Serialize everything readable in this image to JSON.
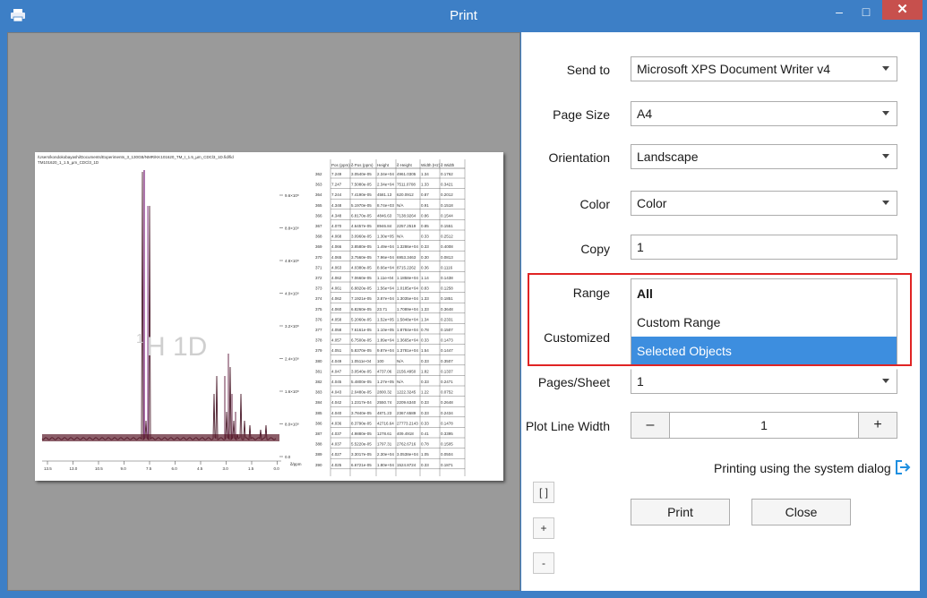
{
  "window": {
    "title": "Print",
    "minimize": "–",
    "maximize": "□",
    "close": "✕"
  },
  "preview": {
    "file_path": "/Users/kondokobayashi/Documents/Experiments_3_130GB/NMR/KK101620_TM_I_1.5_µm_CDCl3_1D.fid/fid",
    "file_name": "TM101620_1_1.5_µm_CDCl3_1D",
    "watermark_sup": "1",
    "watermark": "H 1D",
    "x_ticks": [
      "13.5",
      "13.0",
      "10.5",
      "9.0",
      "7.5",
      "6.0",
      "4.5",
      "3.0",
      "1.5",
      "0.0"
    ],
    "x_unit": "δ/ppm",
    "y_ticks": [
      "9.6×10⁸",
      "8.8×10⁸",
      "4.8×10⁸",
      "4.0×10⁸",
      "3.2×10⁸",
      "2.4×10⁸",
      "1.6×10⁸",
      "8.0×10⁸",
      "0.0"
    ],
    "table_headers": [
      "",
      "Pos (ppm)",
      "δ Pos (ppm)",
      "Height",
      "δ Height",
      "Width (Hz)",
      "δ Width"
    ],
    "table_rows": [
      [
        "362",
        "7.249",
        "3.0540e-05",
        "2.34e+04",
        "4961.0305",
        "1.34",
        "0.1762"
      ],
      [
        "363",
        "7.247",
        "7.5080e-05",
        "2.34e+04",
        "7511.0708",
        "1.33",
        "0.3421"
      ],
      [
        "364",
        "7.244",
        "7.4190e-05",
        "4581.13",
        "620.0912",
        "0.87",
        "0.2012"
      ],
      [
        "365",
        "4.348",
        "5.1970e-05",
        "8.74e+03",
        "N/A",
        "0.91",
        "0.1518"
      ],
      [
        "366",
        "4.348",
        "6.8170e-05",
        "4846.63",
        "7138.9264",
        "0.86",
        "0.1544"
      ],
      [
        "367",
        "4.070",
        "4.6457e-05",
        "8946.84",
        "2257.2519",
        "0.85",
        "0.1551"
      ],
      [
        "368",
        "4.068",
        "3.0960e-05",
        "1.30e+05",
        "N/A",
        "0.33",
        "0.2512"
      ],
      [
        "369",
        "4.066",
        "3.8580e-05",
        "1.49e+04",
        "1.3286e+04",
        "0.33",
        "0.4008"
      ],
      [
        "370",
        "4.065",
        "3.7560e-05",
        "7.96e+04",
        "6953.3463",
        "0.30",
        "0.0813"
      ],
      [
        "371",
        "4.063",
        "4.0380e-05",
        "8.66e+04",
        "8715.2262",
        "0.36",
        "0.1116"
      ],
      [
        "372",
        "4.062",
        "7.0660e-05",
        "1.11e+04",
        "1.1858e+04",
        "1.14",
        "0.1438"
      ],
      [
        "373",
        "4.061",
        "6.8820e-05",
        "1.56e+04",
        "1.0185e+04",
        "0.83",
        "0.1258"
      ],
      [
        "374",
        "4.062",
        "7.1921e-05",
        "3.87e+04",
        "1.3035e+04",
        "1.33",
        "0.1851"
      ],
      [
        "375",
        "4.060",
        "6.8260e-05",
        "23.71",
        "1.7089e+04",
        "1.33",
        "0.3648"
      ],
      [
        "376",
        "4.058",
        "5.2060e-05",
        "1.52e+05",
        "1.5848e+04",
        "1.34",
        "0.2331"
      ],
      [
        "377",
        "4.058",
        "7.6161e-05",
        "1.10e+05",
        "1.8784e+04",
        "0.78",
        "0.1507"
      ],
      [
        "378",
        "4.057",
        "6.7500e-05",
        "1.89e+04",
        "1.3665e+04",
        "0.33",
        "0.1473"
      ],
      [
        "379",
        "4.051",
        "5.8370e-05",
        "9.87e+04",
        "1.3781e+04",
        "1.54",
        "0.1447"
      ],
      [
        "380",
        "4.049",
        "1.0511e-04",
        "100",
        "N/A",
        "0.33",
        "0.3507"
      ],
      [
        "381",
        "4.047",
        "3.0540e-05",
        "4737.06",
        "2156.4950",
        "1.82",
        "0.1337"
      ],
      [
        "382",
        "4.045",
        "5.4800e-05",
        "1.27e+05",
        "N/A",
        "0.33",
        "0.2471"
      ],
      [
        "383",
        "4.043",
        "2.0480e-05",
        "2800.32",
        "1222.3245",
        "1.22",
        "0.0752"
      ],
      [
        "384",
        "4.042",
        "1.2317e-04",
        "2550.74",
        "2209.6340",
        "0.33",
        "0.2648"
      ],
      [
        "385",
        "4.040",
        "3.7840e-05",
        "4871.23",
        "2367.6589",
        "0.33",
        "0.2434"
      ],
      [
        "386",
        "4.036",
        "8.3790e-05",
        "42716.64",
        "27773.2143",
        "0.33",
        "0.1478"
      ],
      [
        "387",
        "4.037",
        "4.9880e-05",
        "1278.61",
        "409.4918",
        "0.41",
        "0.3395"
      ],
      [
        "388",
        "4.037",
        "5.5220e-05",
        "1797.31",
        "2762.6716",
        "0.78",
        "0.1505"
      ],
      [
        "389",
        "4.027",
        "3.3017e-05",
        "2.30e+04",
        "3.0538e+04",
        "1.05",
        "0.0504"
      ],
      [
        "390",
        "4.025",
        "6.6721e-05",
        "1.80e+04",
        "1524.8724",
        "0.33",
        "0.1871"
      ]
    ]
  },
  "panel": {
    "send_to": {
      "label": "Send to",
      "value": "Microsoft XPS Document Writer v4"
    },
    "page_size": {
      "label": "Page Size",
      "value": "A4"
    },
    "orientation": {
      "label": "Orientation",
      "value": "Landscape"
    },
    "color": {
      "label": "Color",
      "value": "Color"
    },
    "copy": {
      "label": "Copy",
      "value": "1"
    },
    "range": {
      "label": "Range",
      "options": [
        "All",
        "Custom Range",
        "Selected Objects"
      ],
      "selected": "Selected Objects"
    },
    "customized": {
      "label": "Customized"
    },
    "pages_sheet": {
      "label": "Pages/Sheet",
      "value": "1"
    },
    "plot_line_width": {
      "label": "Plot Line Width",
      "value": "1",
      "minus": "–",
      "plus": "+"
    },
    "system_dialog": "Printing using the system dialog",
    "side_buttons": {
      "fit": "[ ]",
      "zoom_in": "+",
      "zoom_out": "-"
    },
    "print_button": "Print",
    "close_button": "Close"
  }
}
